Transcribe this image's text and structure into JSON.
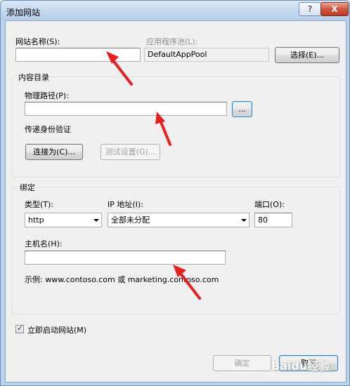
{
  "window": {
    "title": "添加网站",
    "help_label": "?",
    "close_label": "X"
  },
  "site_name": {
    "label": "网站名称(S):",
    "value": ""
  },
  "app_pool": {
    "label": "应用程序池(L):",
    "value": "DefaultAppPool",
    "select_button": "选择(E)..."
  },
  "content_dir": {
    "group_title": "内容目录",
    "path_label": "物理路径(P):",
    "path_value": "",
    "browse_button": "...",
    "auth_label": "传递身份验证",
    "connect_as_button": "连接为(C)...",
    "test_settings_button": "测试设置(G)..."
  },
  "binding": {
    "group_title": "绑定",
    "type_label": "类型(T):",
    "type_value": "http",
    "ip_label": "IP 地址(I):",
    "ip_value": "全部未分配",
    "port_label": "端口(O):",
    "port_value": "80",
    "host_label": "主机名(H):",
    "host_value": "",
    "example_text": "示例: www.contoso.com 或 marketing.contoso.com"
  },
  "start_site": {
    "label": "立即启动网站(M)",
    "checked": true
  },
  "footer": {
    "ok_button": "确定",
    "cancel_button": "取消"
  },
  "watermark": "Baidu经验",
  "colors": {
    "annotation_arrow": "#e5201f"
  }
}
